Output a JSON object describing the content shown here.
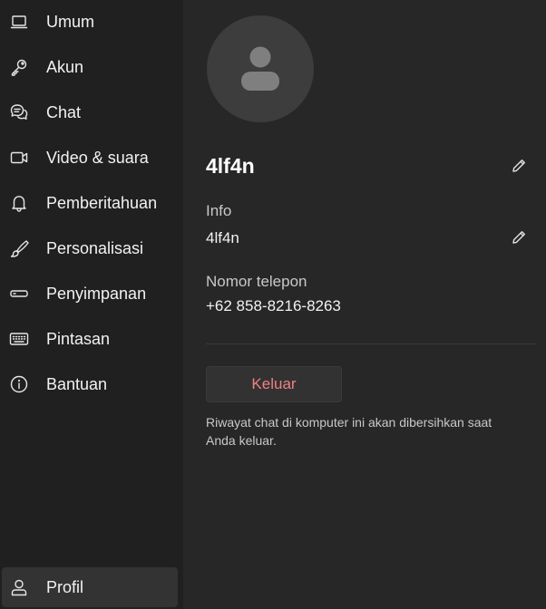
{
  "sidebar": {
    "items": [
      {
        "label": "Umum",
        "icon": "laptop-icon"
      },
      {
        "label": "Akun",
        "icon": "key-icon"
      },
      {
        "label": "Chat",
        "icon": "chat-icon"
      },
      {
        "label": "Video & suara",
        "icon": "video-icon"
      },
      {
        "label": "Pemberitahuan",
        "icon": "bell-icon"
      },
      {
        "label": "Personalisasi",
        "icon": "brush-icon"
      },
      {
        "label": "Penyimpanan",
        "icon": "storage-icon"
      },
      {
        "label": "Pintasan",
        "icon": "keyboard-icon"
      },
      {
        "label": "Bantuan",
        "icon": "info-icon"
      }
    ],
    "profile": {
      "label": "Profil",
      "icon": "person-icon",
      "active": true
    }
  },
  "profile": {
    "name": "4lf4n",
    "info_label": "Info",
    "info_value": "4lf4n",
    "phone_label": "Nomor telepon",
    "phone_value": "+62 858-8216-8263",
    "logout_label": "Keluar",
    "logout_note": "Riwayat chat di komputer ini akan dibersihkan saat Anda keluar."
  },
  "colors": {
    "sidebar_bg": "#202020",
    "main_bg": "#272727",
    "active_item_bg": "#333333",
    "logout_text": "#f08080",
    "avatar_bg": "#3d3d3d"
  }
}
